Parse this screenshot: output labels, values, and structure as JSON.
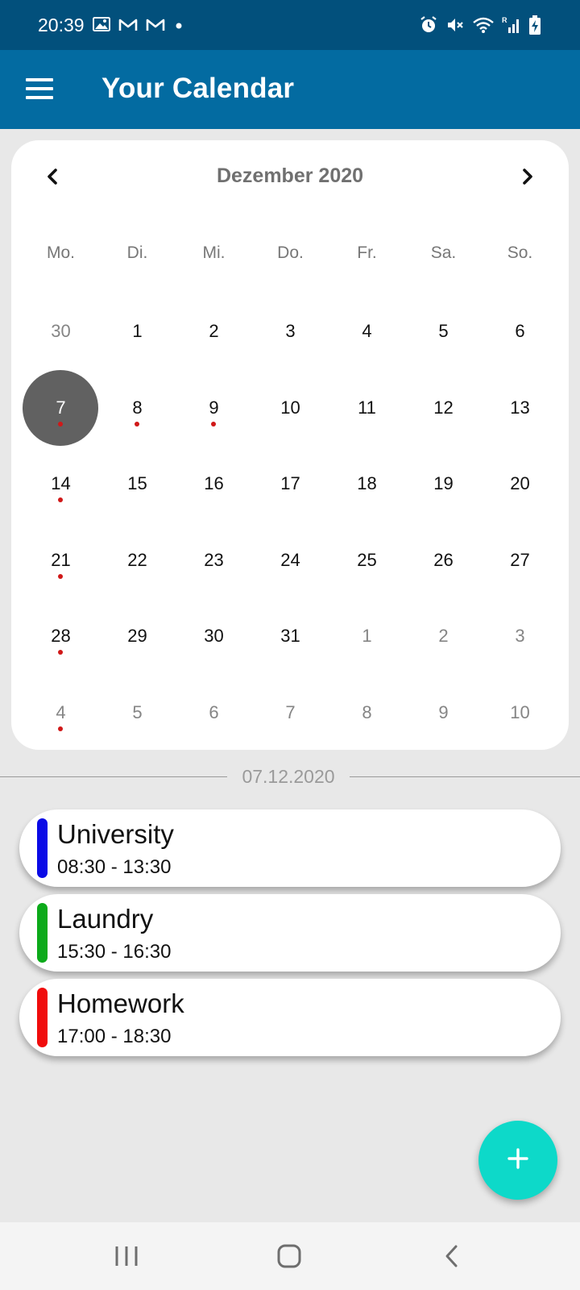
{
  "status_bar": {
    "time": "20:39",
    "left_icons": [
      "image-icon",
      "gmail-icon",
      "gmail-icon",
      "dot-icon"
    ],
    "right_icons": [
      "alarm-icon",
      "mute-icon",
      "wifi-icon",
      "signal-icon",
      "battery-charging-icon"
    ]
  },
  "app_bar": {
    "title": "Your Calendar",
    "menu_icon": "hamburger-menu-icon"
  },
  "calendar": {
    "month_label": "Dezember 2020",
    "prev_icon": "chevron-left-icon",
    "next_icon": "chevron-right-icon",
    "weekdays": [
      "Mo.",
      "Di.",
      "Mi.",
      "Do.",
      "Fr.",
      "Sa.",
      "So."
    ],
    "weeks": [
      [
        {
          "d": "30",
          "other": true
        },
        {
          "d": "1"
        },
        {
          "d": "2"
        },
        {
          "d": "3"
        },
        {
          "d": "4"
        },
        {
          "d": "5"
        },
        {
          "d": "6"
        }
      ],
      [
        {
          "d": "7",
          "selected": true,
          "event": true
        },
        {
          "d": "8",
          "event": true
        },
        {
          "d": "9",
          "event": true
        },
        {
          "d": "10"
        },
        {
          "d": "11"
        },
        {
          "d": "12"
        },
        {
          "d": "13"
        }
      ],
      [
        {
          "d": "14",
          "event": true
        },
        {
          "d": "15"
        },
        {
          "d": "16"
        },
        {
          "d": "17"
        },
        {
          "d": "18"
        },
        {
          "d": "19"
        },
        {
          "d": "20"
        }
      ],
      [
        {
          "d": "21",
          "event": true
        },
        {
          "d": "22"
        },
        {
          "d": "23"
        },
        {
          "d": "24"
        },
        {
          "d": "25"
        },
        {
          "d": "26"
        },
        {
          "d": "27"
        }
      ],
      [
        {
          "d": "28",
          "event": true
        },
        {
          "d": "29"
        },
        {
          "d": "30"
        },
        {
          "d": "31"
        },
        {
          "d": "1",
          "other": true
        },
        {
          "d": "2",
          "other": true
        },
        {
          "d": "3",
          "other": true
        }
      ],
      [
        {
          "d": "4",
          "other": true,
          "event": true
        },
        {
          "d": "5",
          "other": true
        },
        {
          "d": "6",
          "other": true
        },
        {
          "d": "7",
          "other": true
        },
        {
          "d": "8",
          "other": true
        },
        {
          "d": "9",
          "other": true
        },
        {
          "d": "10",
          "other": true
        }
      ]
    ],
    "selected_color": "#616161",
    "event_dot_color": "#d01818"
  },
  "selected_date": "07.12.2020",
  "events": [
    {
      "title": "University",
      "time": "08:30 - 13:30",
      "color": "#0a0ae6"
    },
    {
      "title": "Laundry",
      "time": "15:30 - 16:30",
      "color": "#0caa1a"
    },
    {
      "title": "Homework",
      "time": "17:00 - 18:30",
      "color": "#f00c0c"
    }
  ],
  "fab": {
    "icon": "plus-icon",
    "color": "#0dd9c9"
  },
  "system_nav": {
    "icons": [
      "recent-apps-icon",
      "home-icon",
      "back-icon"
    ]
  },
  "colors": {
    "status_bar": "#02507c",
    "app_bar": "#036ba1",
    "background": "#e8e8e8"
  }
}
